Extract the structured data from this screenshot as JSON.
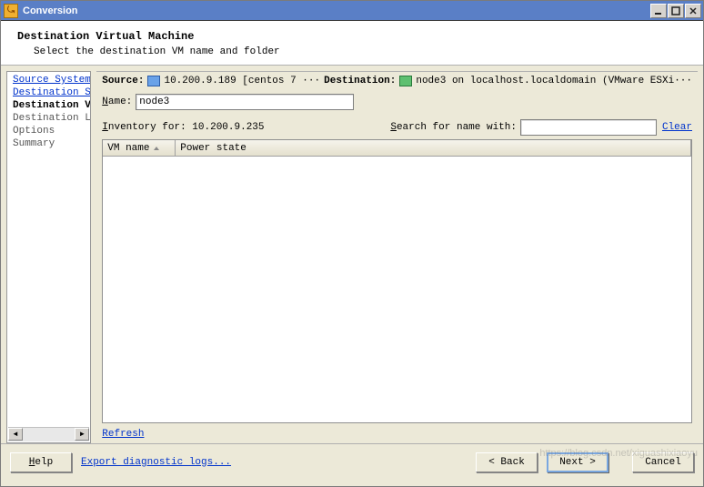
{
  "window": {
    "title": "Conversion",
    "min_tooltip": "Minimize",
    "max_tooltip": "Maximize",
    "close_tooltip": "Close"
  },
  "header": {
    "title": "Destination Virtual Machine",
    "subtitle": "Select the destination VM name and folder"
  },
  "sidebar": {
    "items": [
      {
        "label": "Source System",
        "state": "link"
      },
      {
        "label": "Destination System",
        "state": "link"
      },
      {
        "label": "Destination Virtual Machine",
        "state": "current",
        "display": "Destination Virtua"
      },
      {
        "label": "Destination Location",
        "state": "future"
      },
      {
        "label": "Options",
        "state": "future"
      },
      {
        "label": "Summary",
        "state": "future"
      }
    ]
  },
  "main": {
    "source_label": "Source:",
    "source_value": "10.200.9.189 [centos 7 ···",
    "dest_label": "Destination:",
    "dest_value": "node3 on localhost.localdomain (VMware ESXi···",
    "name_label_pre": "N",
    "name_label_post": "ame:",
    "name_value": "node3",
    "inventory_label_pre": "I",
    "inventory_label_post": "nventory for: 10.200.9.235",
    "search_label_pre": "S",
    "search_label_post": "earch for name with:",
    "search_value": "",
    "search_placeholder": "",
    "clear_link": "Clear",
    "table": {
      "columns": [
        "VM name",
        "Power state"
      ],
      "rows": []
    },
    "refresh_link": "Refresh"
  },
  "footer": {
    "help_label_pre": "H",
    "help_label_post": "elp",
    "export_link": "Export diagnostic logs...",
    "back_label": "< Back",
    "next_label": "Next >",
    "cancel_label": "Cancel"
  },
  "watermark": "https://blog.csdn.net/xiguashixiaoyu"
}
